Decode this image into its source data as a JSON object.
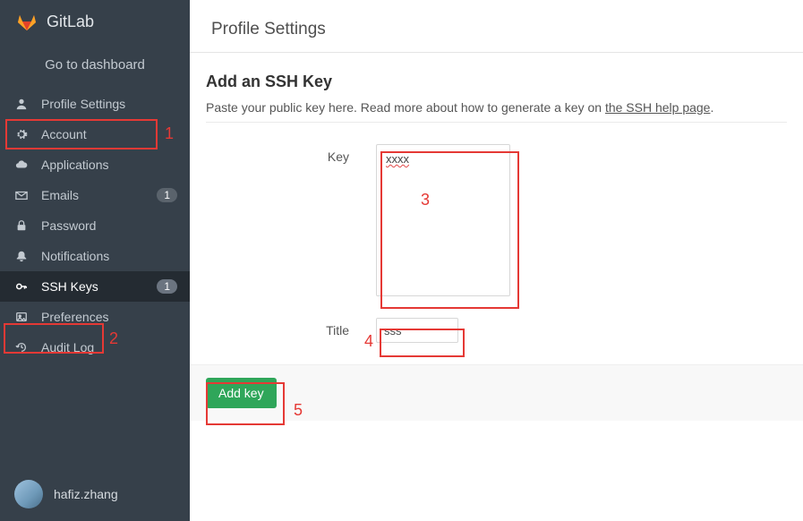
{
  "brand": {
    "label": "GitLab"
  },
  "dashboard_link": "Go to dashboard",
  "sidebar": {
    "items": [
      {
        "label": "Profile Settings",
        "icon": "user-icon",
        "badge": null,
        "active": false
      },
      {
        "label": "Account",
        "icon": "gear-icon",
        "badge": null,
        "active": false
      },
      {
        "label": "Applications",
        "icon": "cloud-icon",
        "badge": null,
        "active": false
      },
      {
        "label": "Emails",
        "icon": "envelope-icon",
        "badge": "1",
        "active": false
      },
      {
        "label": "Password",
        "icon": "lock-icon",
        "badge": null,
        "active": false
      },
      {
        "label": "Notifications",
        "icon": "bell-icon",
        "badge": null,
        "active": false
      },
      {
        "label": "SSH Keys",
        "icon": "key-icon",
        "badge": "1",
        "active": true
      },
      {
        "label": "Preferences",
        "icon": "image-icon",
        "badge": null,
        "active": false
      },
      {
        "label": "Audit Log",
        "icon": "history-icon",
        "badge": null,
        "active": false
      }
    ]
  },
  "user": {
    "name": "hafiz.zhang"
  },
  "page": {
    "title": "Profile Settings",
    "heading": "Add an SSH Key",
    "help_pre": "Paste your public key here. Read more about how to generate a key on ",
    "help_link": "the SSH help page",
    "help_post": ".",
    "key_label": "Key",
    "key_value": "xxxx",
    "title_label": "Title",
    "title_value": "sss",
    "submit_label": "Add key"
  },
  "annotations": {
    "n1": "1",
    "n2": "2",
    "n3": "3",
    "n4": "4",
    "n5": "5"
  }
}
